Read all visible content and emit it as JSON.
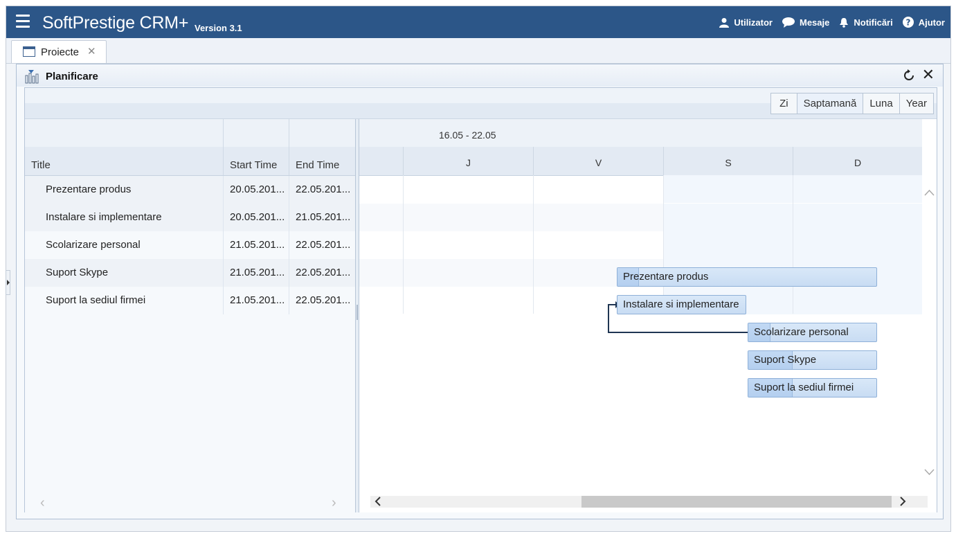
{
  "app": {
    "title": "SoftPrestige CRM+",
    "version": "Version 3.1"
  },
  "top_nav": [
    {
      "label": "Utilizator",
      "icon": "user-icon"
    },
    {
      "label": "Mesaje",
      "icon": "chat-bubble-icon"
    },
    {
      "label": "Notificări",
      "icon": "bell-icon"
    },
    {
      "label": "Ajutor",
      "icon": "help-circle-icon"
    }
  ],
  "tabs": [
    {
      "label": "Proiecte",
      "close": "✕"
    }
  ],
  "panel": {
    "title": "Planificare"
  },
  "view_buttons": [
    "Zi",
    "Saptamană",
    "Luna",
    "Year"
  ],
  "grid": {
    "columns": [
      "Title",
      "Start Time",
      "End Time"
    ],
    "rows": [
      {
        "title": "Prezentare produs",
        "start": "20.05.201...",
        "end": "22.05.201..."
      },
      {
        "title": "Instalare si implementare",
        "start": "20.05.201...",
        "end": "21.05.201..."
      },
      {
        "title": "Scolarizare personal",
        "start": "21.05.201...",
        "end": "22.05.201..."
      },
      {
        "title": "Suport Skype",
        "start": "21.05.201...",
        "end": "22.05.201..."
      },
      {
        "title": "Suport la sediul firmei",
        "start": "21.05.201...",
        "end": "22.05.201..."
      }
    ]
  },
  "gantt": {
    "week_label": "16.05 - 22.05",
    "days": [
      "J",
      "V",
      "S",
      "D"
    ],
    "tasks": [
      {
        "label": "Prezentare produs",
        "progress": 0.08
      },
      {
        "label": "Instalare si implementare",
        "progress": 0.0
      },
      {
        "label": "Scolarizare personal",
        "progress": 0.17
      },
      {
        "label": "Suport Skype",
        "progress": 0.34
      },
      {
        "label": "Suport la sediul firmei",
        "progress": 0.34
      }
    ]
  }
}
